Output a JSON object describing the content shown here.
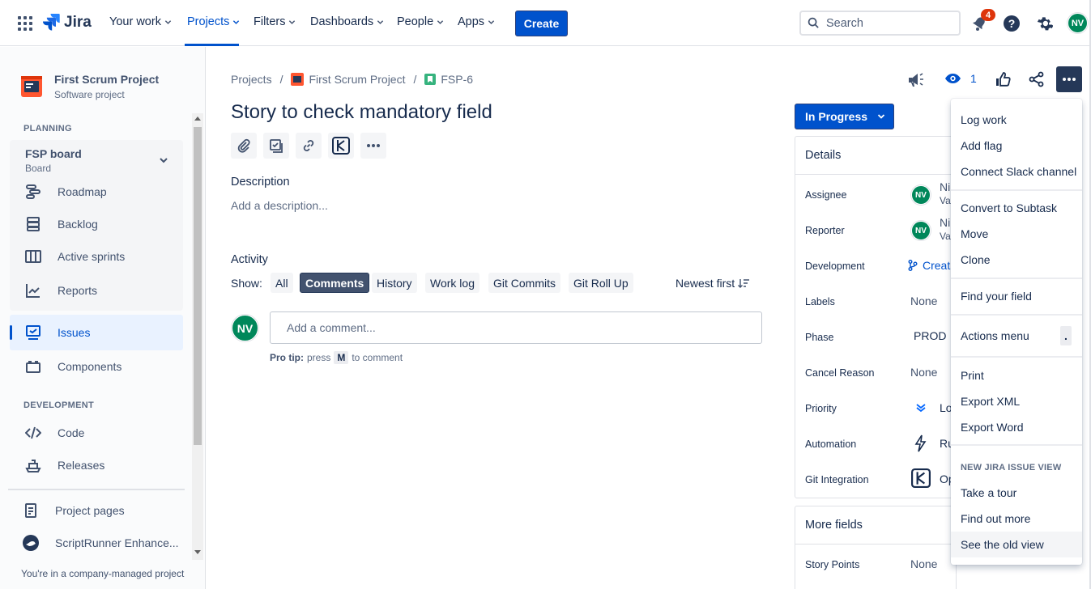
{
  "topnav": {
    "logo_text": "Jira",
    "items": [
      "Your work",
      "Projects",
      "Filters",
      "Dashboards",
      "People",
      "Apps"
    ],
    "create_label": "Create",
    "search_placeholder": "Search",
    "notification_count": "4",
    "avatar_initials": "NV"
  },
  "sidebar": {
    "project_name": "First Scrum Project",
    "project_type": "Software project",
    "planning_heading": "PLANNING",
    "board_name": "FSP board",
    "board_type": "Board",
    "planning_items": [
      "Roadmap",
      "Backlog",
      "Active sprints",
      "Reports"
    ],
    "issues_label": "Issues",
    "components_label": "Components",
    "development_heading": "DEVELOPMENT",
    "development_items": [
      "Code",
      "Releases"
    ],
    "other_items": [
      "Project pages",
      "ScriptRunner Enhance..."
    ],
    "footer": "You're in a company-managed project"
  },
  "breadcrumb": {
    "root": "Projects",
    "sep": "/",
    "project": "First Scrum Project",
    "issue_key": "FSP-6"
  },
  "issue": {
    "title": "Story to check mandatory field",
    "description_heading": "Description",
    "description_placeholder": "Add a description...",
    "watch_count": "1",
    "status": "In Progress"
  },
  "activity": {
    "heading": "Activity",
    "show_label": "Show:",
    "filters": [
      "All",
      "Comments",
      "History",
      "Work log",
      "Git Commits",
      "Git Roll Up"
    ],
    "selected_filter": "Comments",
    "sort_label": "Newest first",
    "comment_placeholder": "Add a comment...",
    "pro_tip_bold": "Pro tip:",
    "pro_tip_press": "press",
    "pro_tip_key": "M",
    "pro_tip_rest": "to comment",
    "avatar_initials": "NV"
  },
  "details": {
    "heading": "Details",
    "rows": [
      {
        "label": "Assignee",
        "value": "Ni",
        "value2": "Va"
      },
      {
        "label": "Reporter",
        "value": "Ni",
        "value2": "Va"
      },
      {
        "label": "Development",
        "value": "Creat"
      },
      {
        "label": "Labels",
        "value": "None"
      },
      {
        "label": "Phase",
        "value": "PROD"
      },
      {
        "label": "Cancel Reason",
        "value": "None"
      },
      {
        "label": "Priority",
        "value": "Lo"
      },
      {
        "label": "Automation",
        "value": "Ru"
      },
      {
        "label": "Git Integration",
        "value": "Op"
      }
    ],
    "more_fields_heading": "More fields",
    "story_points_label": "Story Points",
    "story_points_value": "None"
  },
  "menu": {
    "group1": [
      "Log work",
      "Add flag",
      "Connect Slack channel"
    ],
    "group2": [
      "Convert to Subtask",
      "Move",
      "Clone"
    ],
    "group3": [
      "Find your field"
    ],
    "actions_menu": "Actions menu",
    "actions_shortcut": ".",
    "group5": [
      "Print",
      "Export XML",
      "Export Word"
    ],
    "section_heading": "NEW JIRA ISSUE VIEW",
    "group6": [
      "Take a tour",
      "Find out more",
      "See the old view"
    ]
  },
  "colors": {
    "brand": "#0052cc",
    "avatar": "#00875a",
    "badge": "#de350b",
    "selected_nav_bg": "#e9f2ff"
  }
}
